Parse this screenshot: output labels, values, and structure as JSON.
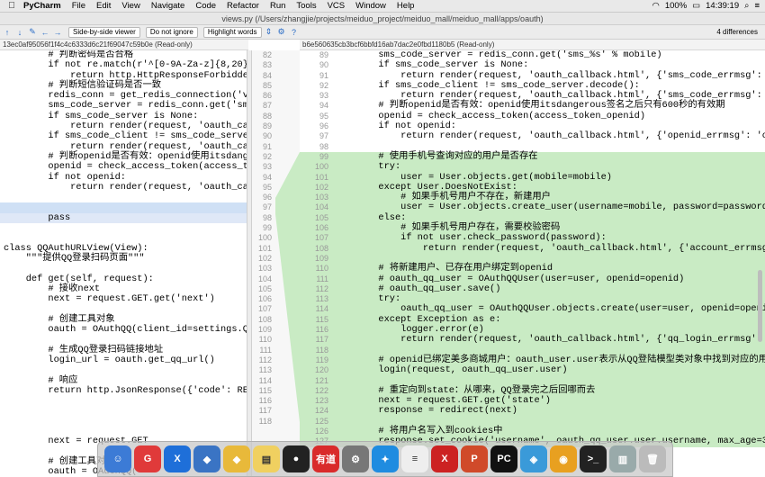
{
  "menubar": {
    "app_name": "PyCharm",
    "items": [
      "File",
      "Edit",
      "View",
      "Navigate",
      "Code",
      "Refactor",
      "Run",
      "Tools",
      "VCS",
      "Window",
      "Help"
    ],
    "battery": "100%",
    "clock": "14:39:19"
  },
  "window": {
    "title": "views.py (/Users/zhangjie/projects/meiduo_project/meiduo_mall/meiduo_mall/apps/oauth)"
  },
  "toolbar": {
    "viewer_mode": "Side-by-side viewer",
    "ignore_mode": "Do not ignore",
    "highlight_mode": "Highlight words",
    "differences": "4 differences"
  },
  "left_file": {
    "header": "13ec0af95056f1f4c4c6333d6c21f69047c59b0e (Read-only)"
  },
  "right_file": {
    "header": "b6e560635cb3bcf6bbfd16ab7dac2e0fbd1180b5 (Read-only)"
  },
  "left_gutter": [
    "82",
    "83",
    "84",
    "85",
    "86",
    "87",
    "88",
    "89",
    "90",
    "91",
    "92",
    "93",
    "94",
    "95",
    "96",
    "97",
    "98",
    "99",
    "100",
    "101",
    "102",
    "103",
    "104",
    "105",
    "106",
    "107",
    "108",
    "109",
    "110",
    "111",
    "112",
    "113",
    "114",
    "115",
    "116",
    "117",
    "118"
  ],
  "left_code": [
    "        # 判断密码是否合格",
    "        if not re.match(r'^[0-9A-Za-z]{8,20}$'",
    "            return http.HttpResponseForbidden(",
    "        # 判断短信验证码是否一致",
    "        redis_conn = get_redis_connection('ver",
    "        sms_code_server = redis_conn.get('sms_",
    "        if sms_code_server is None:",
    "            return render(request, 'oauth_call",
    "        if sms_code_client != sms_code_server.",
    "            return render(request, 'oauth_call",
    "        # 判断openid是否有效：openid使用itsdanger",
    "        openid = check_access_token(access_tok",
    "        if not openid:",
    "            return render(request, 'oauth_call",
    "",
    "",
    "        pass",
    "",
    "",
    "class QQAuthURLView(View):",
    "    \"\"\"提供QQ登录扫码页面\"\"\"",
    "",
    "    def get(self, request):",
    "        # 接收next",
    "        next = request.GET.get('next')",
    "",
    "        # 创建工具对象",
    "        oauth = OAuthQQ(client_id=settings.QQ_",
    "",
    "        # 生成QQ登录扫码链接地址",
    "        login_url = oauth.get_qq_url()",
    "",
    "        # 响应",
    "        return http.JsonResponse({'code': RETC",
    "",
    "",
    "",
    "",
    "        next = request.GET",
    "",
    "        # 创建工具对象",
    "        oauth = OAuthQQ("
  ],
  "right_lines": [
    {
      "n": "89",
      "t": "        sms_code_server = redis_conn.get('sms_%s' % mobile)",
      "add": false
    },
    {
      "n": "90",
      "t": "        if sms_code_server is None:",
      "add": false
    },
    {
      "n": "91",
      "t": "            return render(request, 'oauth_callback.html', {'sms_code_errmsg': '无效的短信",
      "add": false
    },
    {
      "n": "92",
      "t": "        if sms_code_client != sms_code_server.decode():",
      "add": false
    },
    {
      "n": "93",
      "t": "            return render(request, 'oauth_callback.html', {'sms_code_errmsg': '输入短信",
      "add": false
    },
    {
      "n": "94",
      "t": "        # 判断openid是否有效：openid使用itsdangerous签名之后只有600秒的有效期",
      "add": false
    },
    {
      "n": "95",
      "t": "        openid = check_access_token(access_token_openid)",
      "add": false
    },
    {
      "n": "96",
      "t": "        if not openid:",
      "add": false
    },
    {
      "n": "97",
      "t": "            return render(request, 'oauth_callback.html', {'openid_errmsg': 'openid已",
      "add": false
    },
    {
      "n": "98",
      "t": "",
      "add": false
    },
    {
      "n": "99",
      "t": "        # 使用手机号查询对应的用户是否存在",
      "add": true
    },
    {
      "n": "100",
      "t": "        try:",
      "add": true
    },
    {
      "n": "101",
      "t": "            user = User.objects.get(mobile=mobile)",
      "add": true
    },
    {
      "n": "102",
      "t": "        except User.DoesNotExist:",
      "add": true
    },
    {
      "n": "103",
      "t": "            # 如果手机号用户不存在，新建用户",
      "add": true
    },
    {
      "n": "104",
      "t": "            user = User.objects.create_user(username=mobile, password=password, m.",
      "add": true
    },
    {
      "n": "105",
      "t": "        else:",
      "add": true
    },
    {
      "n": "106",
      "t": "            # 如果手机号用户存在，需要校验密码",
      "add": true
    },
    {
      "n": "107",
      "t": "            if not user.check_password(password):",
      "add": true
    },
    {
      "n": "108",
      "t": "                return render(request, 'oauth_callback.html', {'account_errmsg': '账",
      "add": true
    },
    {
      "n": "109",
      "t": "",
      "add": true
    },
    {
      "n": "110",
      "t": "        # 将新建用户、已存在用户绑定到openid",
      "add": true
    },
    {
      "n": "111",
      "t": "        # oauth_qq_user = OAuthQQUser(user=user, openid=openid)",
      "add": true
    },
    {
      "n": "112",
      "t": "        # oauth_qq_user.save()",
      "add": true
    },
    {
      "n": "113",
      "t": "        try:",
      "add": true
    },
    {
      "n": "114",
      "t": "            oauth_qq_user = OAuthQQUser.objects.create(user=user, openid=openid)",
      "add": true
    },
    {
      "n": "115",
      "t": "        except Exception as e:",
      "add": true
    },
    {
      "n": "116",
      "t": "            logger.error(e)",
      "add": true
    },
    {
      "n": "117",
      "t": "            return render(request, 'oauth_callback.html', {'qq_login_errmsg': '账号",
      "add": true
    },
    {
      "n": "118",
      "t": "",
      "add": true
    },
    {
      "n": "119",
      "t": "        # openid已绑定美多商城用户：oauth_user.user表示从QQ登陆模型类对象中找到对应的用户模型类",
      "add": true
    },
    {
      "n": "120",
      "t": "        login(request, oauth_qq_user.user)",
      "add": true
    },
    {
      "n": "121",
      "t": "",
      "add": true
    },
    {
      "n": "122",
      "t": "        # 重定向到state：从哪来，QQ登录完之后回哪而去",
      "add": true
    },
    {
      "n": "123",
      "t": "        next = request.GET.get('state')",
      "add": true
    },
    {
      "n": "124",
      "t": "        response = redirect(next)",
      "add": true
    },
    {
      "n": "125",
      "t": "",
      "add": true
    },
    {
      "n": "126",
      "t": "        # 将用户名写入到cookies中",
      "add": true
    },
    {
      "n": "127",
      "t": "        response.set_cookie('username', oauth_qq_user.user.username, max_age=3600 *",
      "add": true
    }
  ],
  "dock": {
    "apps": [
      {
        "label": "☺",
        "color": "#3c7bd6"
      },
      {
        "label": "G",
        "color": "#e03a3a"
      },
      {
        "label": "X",
        "color": "#1e6fd9"
      },
      {
        "label": "◆",
        "color": "#3a74c4"
      },
      {
        "label": "◆",
        "color": "#e8b93a"
      },
      {
        "label": "▤",
        "color": "#f0d060"
      },
      {
        "label": "●",
        "color": "#222222"
      },
      {
        "label": "有道",
        "color": "#d92b2b"
      },
      {
        "label": "⚙",
        "color": "#777777"
      },
      {
        "label": "✦",
        "color": "#1f8ce0"
      },
      {
        "label": "≡",
        "color": "#eeeeee"
      },
      {
        "label": "X",
        "color": "#c22"
      },
      {
        "label": "P",
        "color": "#d04a2a"
      },
      {
        "label": "PC",
        "color": "#111111"
      },
      {
        "label": "◈",
        "color": "#3a9ad9"
      },
      {
        "label": "◉",
        "color": "#e8a020"
      },
      {
        "label": ">_",
        "color": "#222222"
      },
      {
        "label": "▥",
        "color": "#9aa"
      },
      {
        "label": "🗑",
        "color": "#bbb"
      }
    ]
  }
}
